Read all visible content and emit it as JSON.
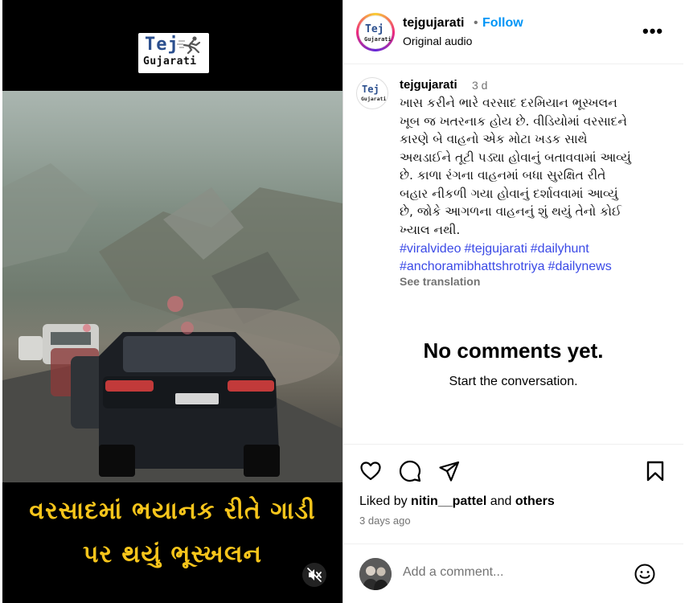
{
  "media": {
    "logo_tej": "Tej",
    "logo_gujarati": "Gujarati",
    "caption_line1": "વરસાદમાં ભયાનક રીતે ગાડી",
    "caption_line2": "પર થયું ભૂસ્ખલન",
    "caption_color": "#f7c51b",
    "mute_icon": "speaker-muted-icon"
  },
  "header": {
    "username": "tejgujarati",
    "separator": "•",
    "follow_label": "Follow",
    "audio": "Original audio",
    "more_label": "•••",
    "avatar_text_top": "Tej",
    "avatar_text_bottom": "Gujarati"
  },
  "caption": {
    "username": "tejgujarati",
    "time": "3 d",
    "lines": [
      "ખાસ કરીને ભારે વરસાદ દરમિયાન ભૂસ્ખલન",
      "ખૂબ જ ખતરનાક હોય છે. વીડિયોમાં વરસાદને",
      "કારણે બે વાહનો એક મોટા ખડક સાથે",
      "અથડાઈને તૂટી પડ્યા હોવાનું બતાવવામાં આવ્યું",
      "છે. કાળા રંગના વાહનમાં બધા સુરક્ષિત રીતે",
      "બહાર નીકળી ગયા હોવાનું દર્શાવવામાં આવ્યું",
      "છે, જોકે આગળના વાહનનું શું થયું તેનો કોઈ",
      "ખ્યાલ નથી."
    ],
    "hashtags": [
      "#viralvideo",
      "#tejgujarati",
      "#dailyhunt",
      "#anchoramibhattshrotriya",
      "#dailynews"
    ],
    "see_translation": "See translation"
  },
  "comments": {
    "empty_title": "No comments yet.",
    "empty_subtitle": "Start the conversation."
  },
  "actions": {
    "icons": [
      "heart-icon",
      "comment-icon",
      "share-icon",
      "bookmark-icon"
    ],
    "liked_prefix": "Liked by",
    "liked_user": "nitin__pattel",
    "liked_and": "and",
    "liked_others": "others",
    "posted_ago": "3 days ago"
  },
  "composer": {
    "placeholder": "Add a comment...",
    "emoji_icon": "emoji-icon"
  },
  "colors": {
    "accent": "#0095f6",
    "hashtag": "#3b4ae6",
    "muted": "#737373"
  }
}
